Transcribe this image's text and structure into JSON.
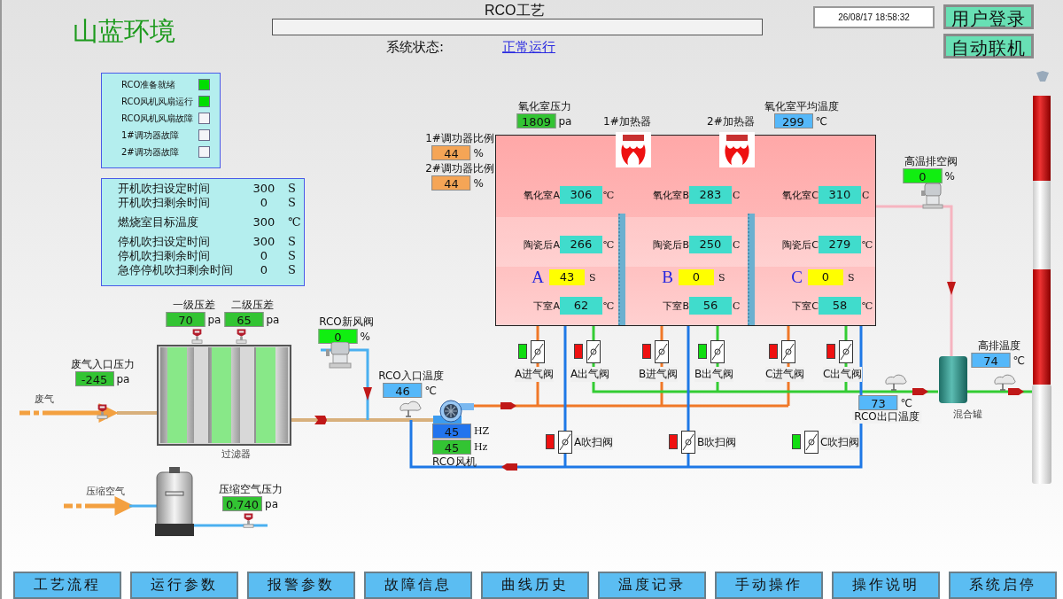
{
  "header": {
    "logo": "山蓝环境",
    "title": "RCO工艺",
    "status_label": "系统状态:",
    "status_value": "正常运行",
    "datetime": "26/08/17 18:58:32",
    "buttons": [
      "用户登录",
      "自动联机"
    ]
  },
  "indicators": [
    {
      "label": "RCO准备就绪",
      "on": true
    },
    {
      "label": "RCO风机风扇运行",
      "on": true
    },
    {
      "label": "RCO风机风扇故障",
      "on": false
    },
    {
      "label": "1#调功器故障",
      "on": false
    },
    {
      "label": "2#调功器故障",
      "on": false
    }
  ],
  "params": [
    {
      "label": "开机吹扫设定时间",
      "value": "300",
      "unit": "S"
    },
    {
      "label": "开机吹扫剩余时间",
      "value": "0",
      "unit": "S"
    },
    {
      "label": "燃烧室目标温度",
      "value": "300",
      "unit": "℃"
    },
    {
      "label": "停机吹扫设定时间",
      "value": "300",
      "unit": "S"
    },
    {
      "label": "停机吹扫剩余时间",
      "value": "0",
      "unit": "S"
    },
    {
      "label": "急停停机吹扫剩余时间",
      "value": "0",
      "unit": "S"
    }
  ],
  "readouts": [
    {
      "label": "氧化室压力",
      "value": "1809",
      "unit": "pa",
      "color": "#33c433"
    },
    {
      "label": "氧化室平均温度",
      "value": "299",
      "unit": "℃",
      "color": "#55b8fa"
    },
    {
      "label": "1#调功器比例",
      "value": "44",
      "unit": "%",
      "color": "#f5a556"
    },
    {
      "label": "2#调功器比例",
      "value": "44",
      "unit": "%",
      "color": "#f5a556"
    },
    {
      "label": "高温排空阀",
      "value": "0",
      "unit": "%",
      "color": "#11ee11"
    },
    {
      "label": "一级压差",
      "value": "70",
      "unit": "pa",
      "color": "#33c433"
    },
    {
      "label": "二级压差",
      "value": "65",
      "unit": "pa",
      "color": "#33c433"
    },
    {
      "label": "RCO新风阀",
      "value": "0",
      "unit": "%",
      "color": "#11ee11"
    },
    {
      "label": "废气入口压力",
      "value": "-245",
      "unit": "pa",
      "color": "#33c433"
    },
    {
      "label": "RCO入口温度",
      "value": "46",
      "unit": "℃",
      "color": "#55b8fa"
    },
    {
      "label": "RCO出口温度",
      "value": "73",
      "unit": "℃",
      "color": "#55b8fa"
    },
    {
      "label": "高排温度",
      "value": "74",
      "unit": "℃",
      "color": "#55b8fa"
    },
    {
      "label": "压缩空气压力",
      "value": "0.740",
      "unit": "pa",
      "color": "#33c433"
    }
  ],
  "heaters": [
    {
      "label": "1#加热器"
    },
    {
      "label": "2#加热器"
    }
  ],
  "chamber": [
    {
      "letter": "A",
      "oxidation": {
        "label": "氧化室A",
        "value": "306",
        "unit": "℃"
      },
      "ceramic": {
        "label": "陶瓷后A",
        "value": "266",
        "unit": "℃"
      },
      "timer": {
        "value": "43",
        "unit": "S"
      },
      "lower": {
        "label": "下室A",
        "value": "62",
        "unit": "℃"
      }
    },
    {
      "letter": "B",
      "oxidation": {
        "label": "氧化室B",
        "value": "283",
        "unit": "C"
      },
      "ceramic": {
        "label": "陶瓷后B",
        "value": "250",
        "unit": "C"
      },
      "timer": {
        "value": "0",
        "unit": "S"
      },
      "lower": {
        "label": "下室B",
        "value": "56",
        "unit": "C"
      }
    },
    {
      "letter": "C",
      "oxidation": {
        "label": "氧化室C",
        "value": "310",
        "unit": "C"
      },
      "ceramic": {
        "label": "陶瓷后C",
        "value": "279",
        "unit": "℃"
      },
      "timer": {
        "value": "0",
        "unit": "S"
      },
      "lower": {
        "label": "下室C",
        "value": "58",
        "unit": "℃"
      }
    }
  ],
  "valves": [
    {
      "label": "A进气阀",
      "open": true
    },
    {
      "label": "A出气阀",
      "open": false
    },
    {
      "label": "B进气阀",
      "open": false
    },
    {
      "label": "B出气阀",
      "open": true
    },
    {
      "label": "C进气阀",
      "open": false
    },
    {
      "label": "C出气阀",
      "open": false
    },
    {
      "label": "A吹扫阀",
      "open": false
    },
    {
      "label": "B吹扫阀",
      "open": false
    },
    {
      "label": "C吹扫阀",
      "open": true
    }
  ],
  "fan": {
    "label": "RCO风机",
    "readouts": [
      {
        "value": "45",
        "unit": "HZ",
        "color": "#2274ee"
      },
      {
        "value": "45",
        "unit": "Hz",
        "color": "#33c433"
      }
    ]
  },
  "equipment_labels": [
    "废气",
    "过滤器",
    "压缩空气",
    "混合罐"
  ],
  "nav": [
    "工艺流程",
    "运行参数",
    "报警参数",
    "故障信息",
    "曲线历史",
    "温度记录",
    "手动操作",
    "操作说明",
    "系统启停"
  ]
}
